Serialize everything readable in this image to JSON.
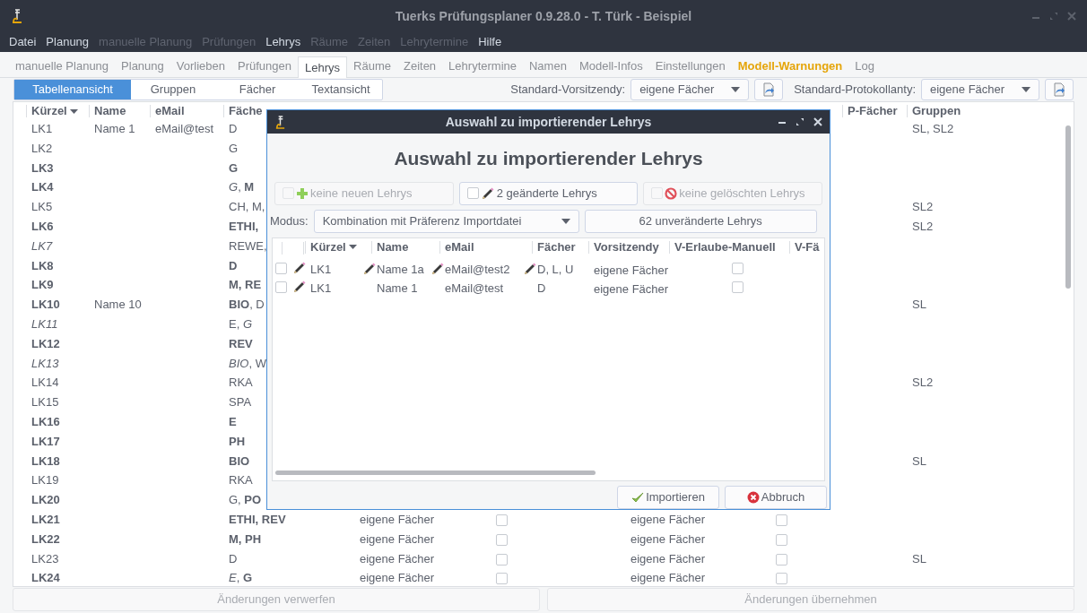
{
  "window": {
    "title": "Tuerks Prüfungsplaner 0.9.28.0 - T. Türk - Beispiel"
  },
  "menu": [
    {
      "label": "Datei",
      "disabled": false
    },
    {
      "label": "Planung",
      "disabled": false
    },
    {
      "label": "manuelle Planung",
      "disabled": true
    },
    {
      "label": "Prüfungen",
      "disabled": true
    },
    {
      "label": "Lehrys",
      "disabled": false
    },
    {
      "label": "Räume",
      "disabled": true
    },
    {
      "label": "Zeiten",
      "disabled": true
    },
    {
      "label": "Lehrytermine",
      "disabled": true
    },
    {
      "label": "Hilfe",
      "disabled": false
    }
  ],
  "tabs": [
    {
      "label": "manuelle Planung",
      "selected": false,
      "warning": false
    },
    {
      "label": "Planung",
      "selected": false,
      "warning": false
    },
    {
      "label": "Vorlieben",
      "selected": false,
      "warning": false
    },
    {
      "label": "Prüfungen",
      "selected": false,
      "warning": false
    },
    {
      "label": "Lehrys",
      "selected": true,
      "warning": false
    },
    {
      "label": "Räume",
      "selected": false,
      "warning": false
    },
    {
      "label": "Zeiten",
      "selected": false,
      "warning": false
    },
    {
      "label": "Lehrytermine",
      "selected": false,
      "warning": false
    },
    {
      "label": "Namen",
      "selected": false,
      "warning": false
    },
    {
      "label": "Modell-Infos",
      "selected": false,
      "warning": false
    },
    {
      "label": "Einstellungen",
      "selected": false,
      "warning": false
    },
    {
      "label": "Modell-Warnungen",
      "selected": false,
      "warning": true
    },
    {
      "label": "Log",
      "selected": false,
      "warning": false
    }
  ],
  "view_tabs": [
    {
      "label": "Tabellenansicht",
      "selected": true
    },
    {
      "label": "Gruppen",
      "selected": false
    },
    {
      "label": "Fächer",
      "selected": false
    },
    {
      "label": "Textansicht",
      "selected": false
    }
  ],
  "toolbar": [
    {
      "label": "Standard-Vorsitzendy:",
      "value": "eigene Fächer"
    },
    {
      "label": "Standard-Protokollanty:",
      "value": "eigene Fächer"
    }
  ],
  "table": {
    "columns": [
      {
        "label": "Kürzel",
        "sorted": true
      },
      {
        "label": "Name",
        "sorted": false
      },
      {
        "label": "eMail",
        "sorted": false
      },
      {
        "label": "Fäche",
        "sorted": false
      },
      {
        "label": "P-Fächer",
        "sorted": false
      },
      {
        "label": "Gruppen",
        "sorted": false
      }
    ],
    "rows": [
      {
        "kuerzel": "LK1",
        "kuerzel_bold": false,
        "kuerzel_italic": false,
        "name": "Name 1",
        "email": "eMail@test",
        "faecher": "D",
        "faecher_bold": false,
        "gruppen": "SL, SL2"
      },
      {
        "kuerzel": "LK2",
        "kuerzel_bold": false,
        "kuerzel_italic": false,
        "faecher": "G",
        "faecher_bold": false
      },
      {
        "kuerzel": "LK3",
        "kuerzel_bold": true,
        "kuerzel_italic": false,
        "faecher": "G",
        "faecher_bold": true
      },
      {
        "kuerzel": "LK4",
        "kuerzel_bold": true,
        "kuerzel_italic": false,
        "faecher": "*G*, **M**",
        "faecher_bold": false
      },
      {
        "kuerzel": "LK5",
        "kuerzel_bold": false,
        "kuerzel_italic": false,
        "faecher": "CH, M,",
        "faecher_bold": false,
        "gruppen": "SL2"
      },
      {
        "kuerzel": "LK6",
        "kuerzel_bold": true,
        "kuerzel_italic": false,
        "faecher": "ETHI,",
        "faecher_bold": true,
        "gruppen": "SL2"
      },
      {
        "kuerzel": "LK7",
        "kuerzel_bold": false,
        "kuerzel_italic": true,
        "faecher": "REWE,",
        "faecher_bold": false
      },
      {
        "kuerzel": "LK8",
        "kuerzel_bold": true,
        "kuerzel_italic": false,
        "faecher": "D",
        "faecher_bold": true
      },
      {
        "kuerzel": "LK9",
        "kuerzel_bold": true,
        "kuerzel_italic": false,
        "faecher": "M, RE",
        "faecher_bold": true
      },
      {
        "kuerzel": "LK10",
        "kuerzel_bold": true,
        "kuerzel_italic": false,
        "name": "Name 10",
        "faecher": "**BIO**, D",
        "faecher_bold": false,
        "gruppen": "SL"
      },
      {
        "kuerzel": "LK11",
        "kuerzel_bold": false,
        "kuerzel_italic": true,
        "faecher": "E, *G*",
        "faecher_bold": false
      },
      {
        "kuerzel": "LK12",
        "kuerzel_bold": true,
        "kuerzel_italic": false,
        "faecher": "REV",
        "faecher_bold": true
      },
      {
        "kuerzel": "LK13",
        "kuerzel_bold": false,
        "kuerzel_italic": true,
        "faecher": "*BIO*, W",
        "faecher_bold": false
      },
      {
        "kuerzel": "LK14",
        "kuerzel_bold": false,
        "kuerzel_italic": false,
        "faecher": "RKA",
        "faecher_bold": false,
        "gruppen": "SL2"
      },
      {
        "kuerzel": "LK15",
        "kuerzel_bold": false,
        "kuerzel_italic": false,
        "faecher": "SPA",
        "faecher_bold": false
      },
      {
        "kuerzel": "LK16",
        "kuerzel_bold": true,
        "kuerzel_italic": false,
        "faecher": "E",
        "faecher_bold": true
      },
      {
        "kuerzel": "LK17",
        "kuerzel_bold": true,
        "kuerzel_italic": false,
        "faecher": "PH",
        "faecher_bold": true
      },
      {
        "kuerzel": "LK18",
        "kuerzel_bold": true,
        "kuerzel_italic": false,
        "faecher": "BIO",
        "faecher_bold": true,
        "gruppen": "SL"
      },
      {
        "kuerzel": "LK19",
        "kuerzel_bold": false,
        "kuerzel_italic": false,
        "faecher": "RKA",
        "faecher_bold": false
      },
      {
        "kuerzel": "LK20",
        "kuerzel_bold": true,
        "kuerzel_italic": false,
        "faecher": "G, **PO**",
        "faecher_bold": false
      },
      {
        "kuerzel": "LK21",
        "kuerzel_bold": true,
        "kuerzel_italic": false,
        "faecher": "ETHI, REV",
        "faecher_bold": true,
        "vorsitz": "eigene Fächer",
        "v_erlaube": false,
        "protokoll": "eigene Fächer",
        "p_erlaube": false
      },
      {
        "kuerzel": "LK22",
        "kuerzel_bold": true,
        "kuerzel_italic": false,
        "faecher": "M, PH",
        "faecher_bold": true,
        "vorsitz": "eigene Fächer",
        "v_erlaube": false,
        "protokoll": "eigene Fächer",
        "p_erlaube": false
      },
      {
        "kuerzel": "LK23",
        "kuerzel_bold": false,
        "kuerzel_italic": false,
        "faecher": "D",
        "faecher_bold": false,
        "vorsitz": "eigene Fächer",
        "v_erlaube": false,
        "protokoll": "eigene Fächer",
        "p_erlaube": false,
        "gruppen": "SL"
      },
      {
        "kuerzel": "LK24",
        "kuerzel_bold": true,
        "kuerzel_italic": false,
        "faecher": "*E*, **G**",
        "faecher_bold": false,
        "vorsitz": "eigene Fächer",
        "v_erlaube": false,
        "protokoll": "eigene Fächer",
        "p_erlaube": false
      }
    ]
  },
  "dialog": {
    "title": "Auswahl zu importierender Lehrys",
    "heading": "Auswahl zu importierender Lehrys",
    "filters": [
      {
        "kind": "new",
        "label": "keine neuen Lehrys",
        "checked": false,
        "disabled": true
      },
      {
        "kind": "changed",
        "label": "2 geänderte Lehrys",
        "checked": false,
        "disabled": false
      },
      {
        "kind": "deleted",
        "label": "keine gelöschten Lehrys",
        "checked": false,
        "disabled": true
      }
    ],
    "mode_label": "Modus:",
    "mode": "Kombination mit Präferenz Importdatei",
    "unchanged_label": "62 unveränderte Lehrys",
    "columns": [
      {
        "label": "Kürzel",
        "sorted": true
      },
      {
        "label": "Name",
        "sorted": false
      },
      {
        "label": "eMail",
        "sorted": false
      },
      {
        "label": "Fächer",
        "sorted": false
      },
      {
        "label": "Vorsitzendy",
        "sorted": false
      },
      {
        "label": "V-Erlaube-Manuell",
        "sorted": false
      },
      {
        "label": "V-Fä",
        "sorted": false
      }
    ],
    "rows": [
      {
        "checked": false,
        "changed": true,
        "kuerzel": {
          "text": "LK1",
          "changed": false
        },
        "name": {
          "text": "Name 1a",
          "changed": true
        },
        "email": {
          "text": "eMail@test2",
          "changed": true
        },
        "faecher": {
          "text": "D, L, U",
          "changed": true
        },
        "vorsitz": "eigene Fächer",
        "v_erlaube": false
      },
      {
        "checked": false,
        "changed": true,
        "kuerzel": {
          "text": "LK1",
          "changed": false
        },
        "name": {
          "text": "Name 1",
          "changed": false
        },
        "email": {
          "text": "eMail@test",
          "changed": false
        },
        "faecher": {
          "text": "D",
          "changed": false
        },
        "vorsitz": "eigene Fächer",
        "v_erlaube": false
      }
    ],
    "buttons": [
      {
        "kind": "ok",
        "label": "Importieren"
      },
      {
        "kind": "cancel",
        "label": "Abbruch"
      }
    ]
  },
  "footer_buttons": [
    {
      "label": "Änderungen verwerfen",
      "disabled": true
    },
    {
      "label": "Änderungen übernehmen",
      "disabled": true
    }
  ]
}
